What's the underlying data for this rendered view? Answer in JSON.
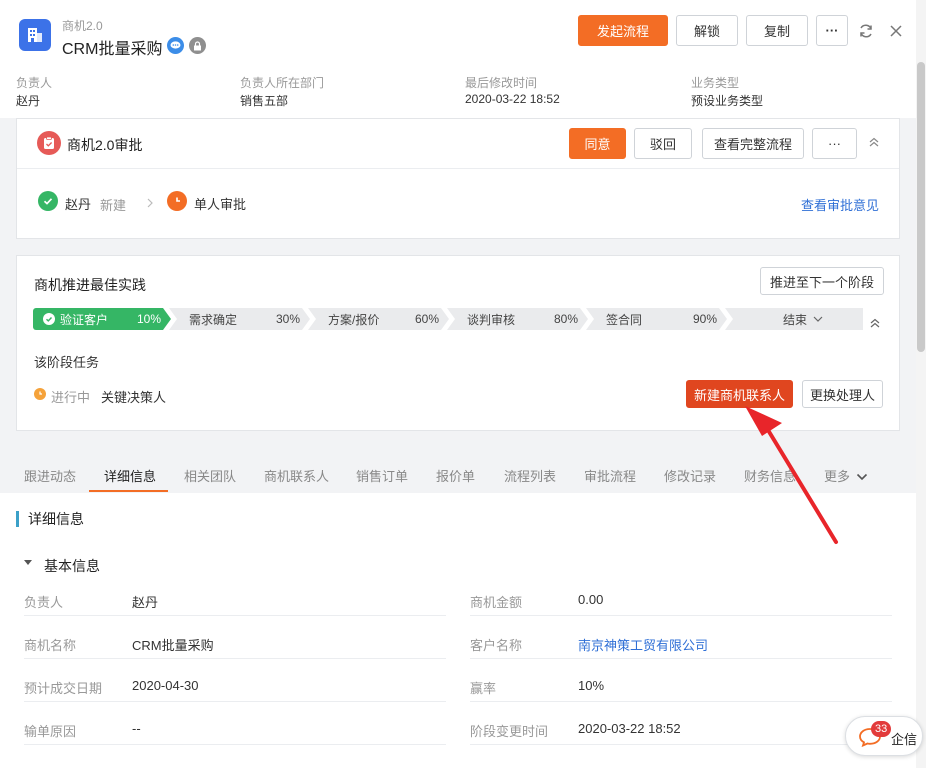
{
  "header": {
    "subtitle": "商机2.0",
    "title": "CRM批量采购",
    "buttons": {
      "start_flow": "发起流程",
      "unlock": "解锁",
      "copy": "复制",
      "more": "···"
    }
  },
  "meta": [
    {
      "label": "负责人",
      "value": "赵丹"
    },
    {
      "label": "负责人所在部门",
      "value": "销售五部"
    },
    {
      "label": "最后修改时间",
      "value": "2020-03-22 18:52"
    },
    {
      "label": "业务类型",
      "value": "预设业务类型"
    }
  ],
  "approval": {
    "title": "商机2.0审批",
    "buttons": {
      "agree": "同意",
      "reject": "驳回",
      "view_flow": "查看完整流程",
      "more": "···"
    },
    "steps": [
      {
        "name": "赵丹",
        "status": "新建"
      },
      {
        "name": "单人审批"
      }
    ],
    "view_opinion": "查看审批意见"
  },
  "stage": {
    "title": "商机推进最佳实践",
    "advance_button": "推进至下一个阶段",
    "segments": [
      {
        "name": "验证客户",
        "percent": "10%"
      },
      {
        "name": "需求确定",
        "percent": "30%"
      },
      {
        "name": "方案/报价",
        "percent": "60%"
      },
      {
        "name": "谈判审核",
        "percent": "80%"
      },
      {
        "name": "签合同",
        "percent": "90%"
      },
      {
        "name": "结束"
      }
    ],
    "task_section": "该阶段任务",
    "task_status": "进行中",
    "task_name": "关键决策人",
    "new_contact_button": "新建商机联系人",
    "change_handler_button": "更换处理人"
  },
  "tabs": [
    "跟进动态",
    "详细信息",
    "相关团队",
    "商机联系人",
    "销售订单",
    "报价单",
    "流程列表",
    "审批流程",
    "修改记录",
    "财务信息",
    "更多"
  ],
  "detail": {
    "heading": "详细信息",
    "group": "基本信息",
    "fields_left": [
      {
        "label": "负责人",
        "value": "赵丹"
      },
      {
        "label": "商机名称",
        "value": "CRM批量采购"
      },
      {
        "label": "预计成交日期",
        "value": "2020-04-30"
      },
      {
        "label": "输单原因",
        "value": "--"
      }
    ],
    "fields_right": [
      {
        "label": "商机金额",
        "value": "0.00"
      },
      {
        "label": "客户名称",
        "value": "南京神策工贸有限公司"
      },
      {
        "label": "赢率",
        "value": "10%"
      },
      {
        "label": "阶段变更时间",
        "value": "2020-03-22 18:52"
      }
    ]
  },
  "chat": {
    "count": "33",
    "label": "企信"
  },
  "colors": {
    "primary": "#f36d25",
    "success": "#35b665",
    "link": "#2f6fd6",
    "annotation": "#e8252a"
  }
}
